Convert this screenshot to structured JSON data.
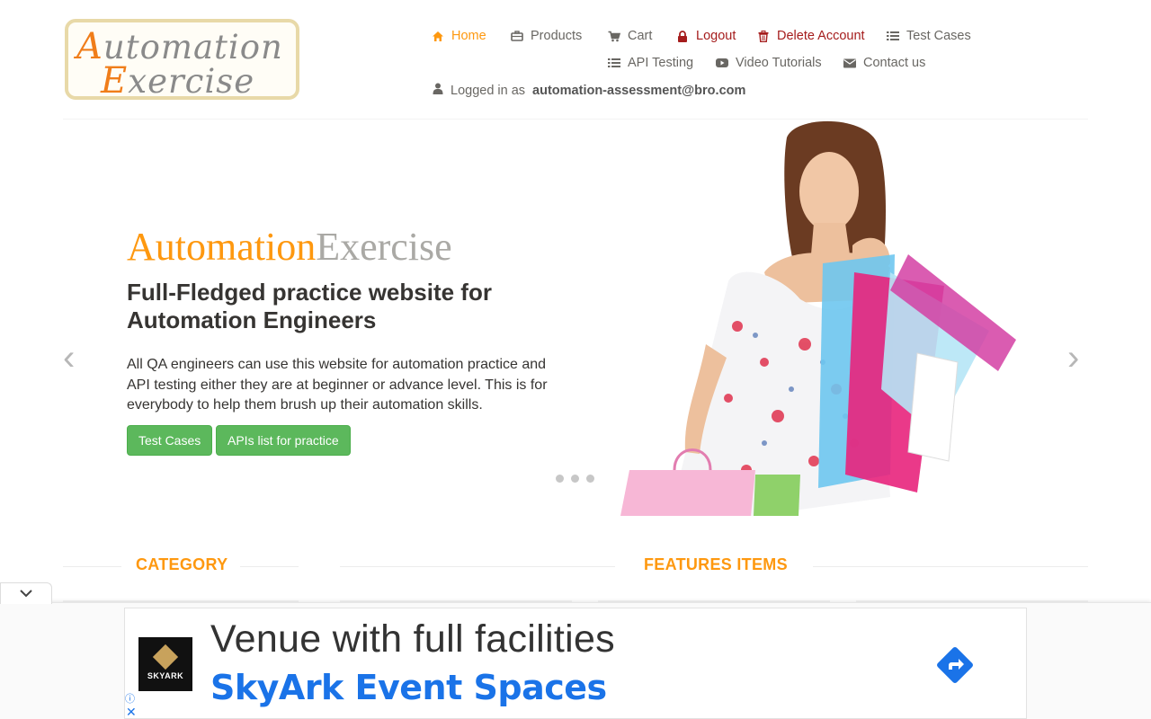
{
  "header": {
    "logo_line1_cap": "A",
    "logo_line1_rest": "utomation",
    "logo_line2_cap": "E",
    "logo_line2_rest": "xercise",
    "nav": {
      "home": "Home",
      "products": "Products",
      "cart": "Cart",
      "logout": "Logout",
      "delete_account": "Delete Account",
      "test_cases": "Test Cases",
      "api_testing": "API Testing",
      "video_tutorials": "Video Tutorials",
      "contact_us": "Contact us"
    },
    "logged_in_prefix": "Logged in as",
    "logged_in_user": "automation-assessment@bro.com"
  },
  "slider": {
    "brand_part1": "Automation",
    "brand_part2": "Exercise",
    "heading": "Full-Fledged practice website for Automation Engineers",
    "description": "All QA engineers can use this website for automation practice and API testing either they are at beginner or advance level. This is for everybody to help them brush up their automation skills.",
    "btn_test_cases": "Test Cases",
    "btn_apis": "APIs list for practice",
    "prev": "‹",
    "next": "›"
  },
  "sections": {
    "category": "CATEGORY",
    "features": "FEATURES ITEMS"
  },
  "ad": {
    "toggle": "⌄",
    "logo_text": "SKYARK",
    "headline": "Venue with full facilities",
    "subline": "SkyArk Event Spaces",
    "info": "ⓘ",
    "close": "✕"
  },
  "colors": {
    "accent": "#fe980f",
    "danger": "#a51d1d",
    "button": "#5cb85c",
    "ad_link": "#1a73e8"
  }
}
